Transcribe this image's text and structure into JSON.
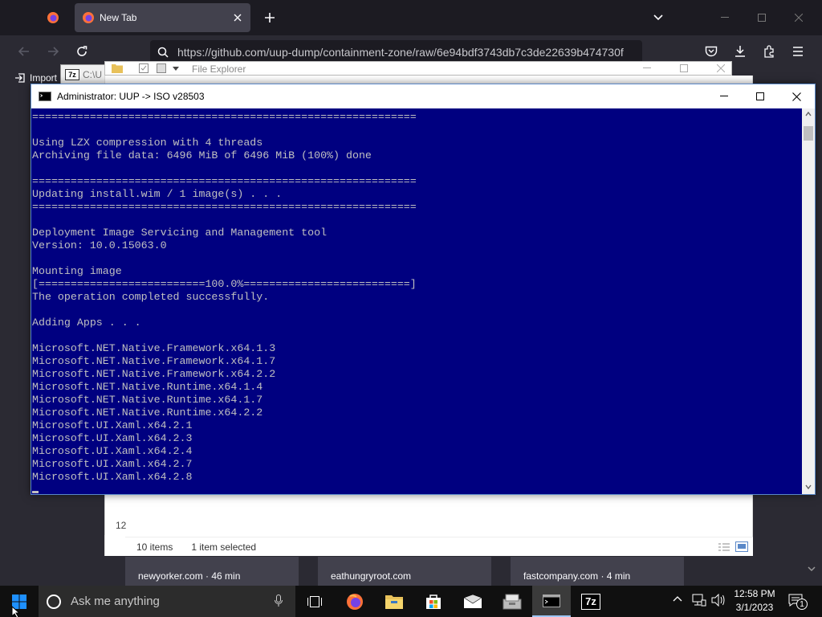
{
  "browser": {
    "active_tab_title": "New Tab",
    "url": "https://github.com/uup-dump/containment-zone/raw/6e94bdf3743db7c3de22639b474730f",
    "bookmark_label": "Import"
  },
  "explorer": {
    "title": "File Explorer",
    "status_items": "10 items",
    "status_selected": "1 item selected",
    "side_number": "12",
    "path_fragment": "C:\\U"
  },
  "news_cards": [
    {
      "label": "newyorker.com · 46 min"
    },
    {
      "label": "eathungryroot.com"
    },
    {
      "label": "fastcompany.com · 4 min"
    }
  ],
  "console": {
    "title": "Administrator:  UUP -> ISO v28503",
    "lines": [
      "============================================================",
      "",
      "Using LZX compression with 4 threads",
      "Archiving file data: 6496 MiB of 6496 MiB (100%) done",
      "",
      "============================================================",
      "Updating install.wim / 1 image(s) . . .",
      "============================================================",
      "",
      "Deployment Image Servicing and Management tool",
      "Version: 10.0.15063.0",
      "",
      "Mounting image",
      "[==========================100.0%==========================]",
      "The operation completed successfully.",
      "",
      "Adding Apps . . .",
      "",
      "Microsoft.NET.Native.Framework.x64.1.3",
      "Microsoft.NET.Native.Framework.x64.1.7",
      "Microsoft.NET.Native.Framework.x64.2.2",
      "Microsoft.NET.Native.Runtime.x64.1.4",
      "Microsoft.NET.Native.Runtime.x64.1.7",
      "Microsoft.NET.Native.Runtime.x64.2.2",
      "Microsoft.UI.Xaml.x64.2.1",
      "Microsoft.UI.Xaml.x64.2.3",
      "Microsoft.UI.Xaml.x64.2.4",
      "Microsoft.UI.Xaml.x64.2.7",
      "Microsoft.UI.Xaml.x64.2.8"
    ]
  },
  "taskbar": {
    "search_placeholder": "Ask me anything",
    "time": "12:58 PM",
    "date": "3/1/2023",
    "notification_count": "1",
    "sevenzip_label": "7z"
  },
  "colors": {
    "console_bg": "#000080",
    "console_fg": "#c0c0c0",
    "firefox_dark": "#1c1b22",
    "start_blue": "#1e90ff"
  }
}
